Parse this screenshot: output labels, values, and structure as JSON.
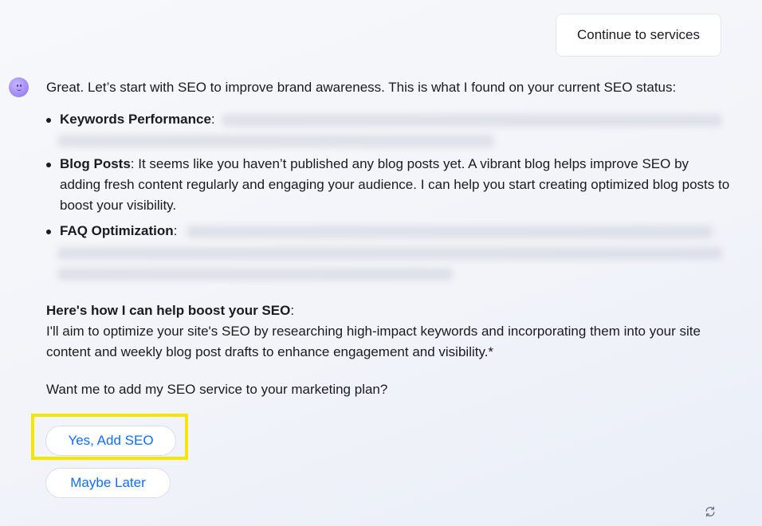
{
  "header": {
    "continue_label": "Continue to services"
  },
  "message": {
    "intro": "Great. Let’s start with SEO to improve brand awareness. This is what I found on your current SEO status:",
    "findings": [
      {
        "label": "Keywords Performance",
        "separator": ":",
        "text": ""
      },
      {
        "label": "Blog Posts",
        "separator": ":",
        "text": " It seems like you haven’t published any blog posts yet. A vibrant blog helps improve SEO by adding fresh content regularly and engaging your audience. I can help you start creating optimized blog posts to boost your visibility."
      },
      {
        "label": "FAQ Optimization",
        "separator": ":",
        "text": ""
      }
    ],
    "help_heading": "Here's how I can help boost your SEO",
    "help_heading_suffix": ":",
    "help_body": "I'll aim to optimize your site's SEO by researching high-impact keywords and incorporating them into your site content and weekly blog post drafts to enhance engagement and visibility.*",
    "question": "Want me to add my SEO service to your marketing plan?"
  },
  "actions": {
    "primary_label": "Yes, Add SEO",
    "secondary_label": "Maybe Later"
  },
  "icons": {
    "avatar": "assistant-avatar-icon",
    "regenerate": "refresh-icon"
  },
  "colors": {
    "accent": "#116dff",
    "highlight": "#f5e600",
    "avatar": "#a48cf5"
  }
}
